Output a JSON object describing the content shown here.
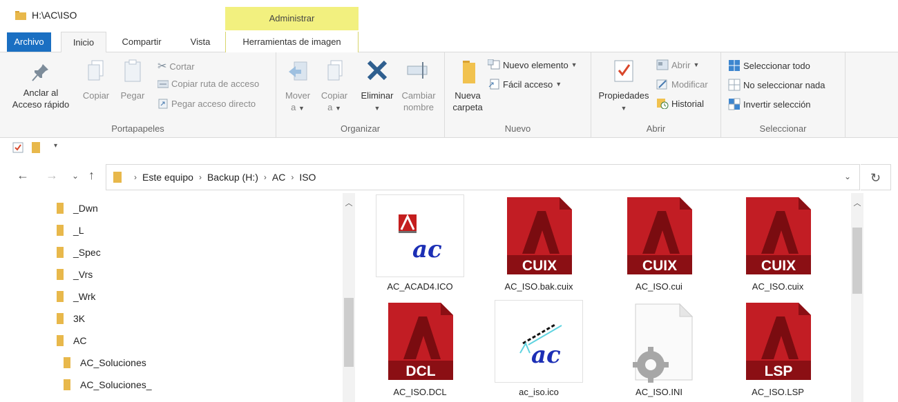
{
  "window": {
    "title": "H:\\AC\\ISO",
    "context_tab": "Administrar"
  },
  "tabs": {
    "archivo": "Archivo",
    "inicio": "Inicio",
    "compartir": "Compartir",
    "vista": "Vista",
    "herramientas": "Herramientas de imagen"
  },
  "ribbon": {
    "portapapeles": {
      "label": "Portapapeles",
      "anclar_1": "Anclar al",
      "anclar_2": "Acceso rápido",
      "copiar": "Copiar",
      "pegar": "Pegar",
      "cortar": "Cortar",
      "copiar_ruta": "Copiar ruta de acceso",
      "pegar_acceso": "Pegar acceso directo"
    },
    "organizar": {
      "label": "Organizar",
      "mover_1": "Mover",
      "mover_2": "a",
      "copiar_1": "Copiar",
      "copiar_2": "a",
      "eliminar": "Eliminar",
      "cambiar_1": "Cambiar",
      "cambiar_2": "nombre"
    },
    "nuevo": {
      "label": "Nuevo",
      "nueva_1": "Nueva",
      "nueva_2": "carpeta",
      "nuevo_elemento": "Nuevo elemento",
      "facil_acceso": "Fácil acceso"
    },
    "abrir": {
      "label": "Abrir",
      "propiedades": "Propiedades",
      "abrir": "Abrir",
      "modificar": "Modificar",
      "historial": "Historial"
    },
    "seleccionar": {
      "label": "Seleccionar",
      "todo": "Seleccionar todo",
      "nada": "No seleccionar nada",
      "invertir": "Invertir selección"
    }
  },
  "breadcrumb": [
    "Este equipo",
    "Backup (H:)",
    "AC",
    "ISO"
  ],
  "nav_tree": [
    {
      "label": "_Dwn"
    },
    {
      "label": "_L"
    },
    {
      "label": "_Spec"
    },
    {
      "label": "_Vrs"
    },
    {
      "label": "_Wrk"
    },
    {
      "label": "3K"
    },
    {
      "label": "AC"
    },
    {
      "label": "AC_Soluciones"
    },
    {
      "label": "AC_Soluciones_"
    }
  ],
  "files": [
    {
      "name": "AC_ACAD4.ICO",
      "kind": "ico-acad"
    },
    {
      "name": "AC_ISO.bak.cuix",
      "kind": "autocad",
      "badge": "CUIX"
    },
    {
      "name": "AC_ISO.cui",
      "kind": "autocad",
      "badge": "CUIX"
    },
    {
      "name": "AC_ISO.cuix",
      "kind": "autocad",
      "badge": "CUIX"
    },
    {
      "name": "AC_ISO.DCL",
      "kind": "autocad",
      "badge": "DCL"
    },
    {
      "name": "ac_iso.ico",
      "kind": "ico-ac"
    },
    {
      "name": "AC_ISO.INI",
      "kind": "ini"
    },
    {
      "name": "AC_ISO.LSP",
      "kind": "autocad",
      "badge": "LSP"
    }
  ],
  "colors": {
    "accent": "#1a6fc2",
    "context_tab": "#f2f07f",
    "autocad_red": "#b3161c",
    "folder": "#e8b84b"
  }
}
